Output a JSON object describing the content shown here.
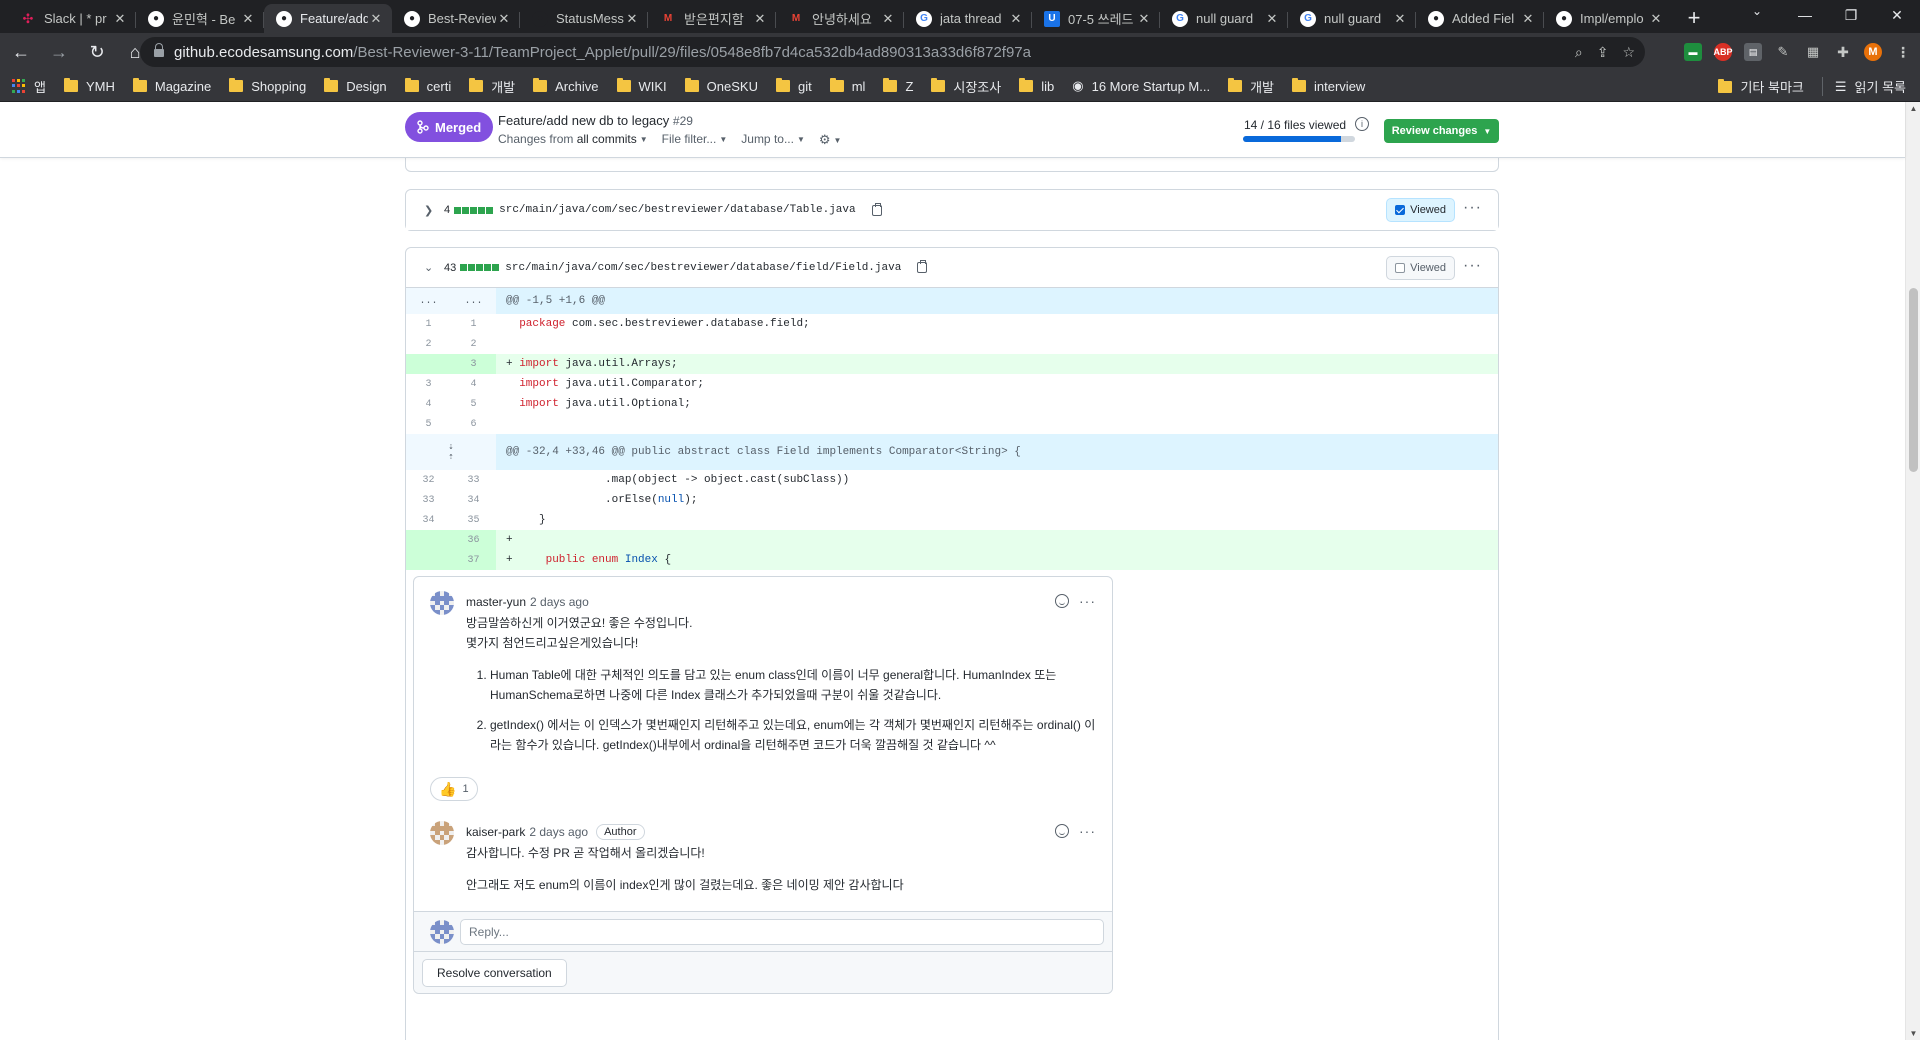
{
  "browser": {
    "tabs": [
      {
        "title": "Slack | * pr",
        "icon": "slack-icon",
        "color": "#e01e5a",
        "active": false
      },
      {
        "title": "윤민혁 - Be",
        "icon": "github-icon",
        "color": "#ffffff",
        "active": false
      },
      {
        "title": "Feature/add",
        "icon": "github-icon",
        "color": "#ffffff",
        "active": true
      },
      {
        "title": "Best-Review",
        "icon": "github-icon",
        "color": "#ffffff",
        "active": false
      },
      {
        "title": "StatusMess",
        "icon": "github-icon",
        "color": "#202124",
        "active": false
      },
      {
        "title": "받은편지함",
        "icon": "gmail-icon",
        "color": "#ea4335",
        "active": false
      },
      {
        "title": "안녕하세요",
        "icon": "gmail-icon",
        "color": "#ea4335",
        "active": false
      },
      {
        "title": "jata thread",
        "icon": "google-icon",
        "color": "#4285f4",
        "active": false
      },
      {
        "title": "07-5 쓰레드",
        "icon": "bookmark-u-icon",
        "color": "#1a73e8",
        "active": false
      },
      {
        "title": "null guard",
        "icon": "google-icon",
        "color": "#4285f4",
        "active": false
      },
      {
        "title": "null guard",
        "icon": "google-icon",
        "color": "#4285f4",
        "active": false
      },
      {
        "title": "Added Fiel",
        "icon": "github-icon",
        "color": "#ffffff",
        "active": false
      },
      {
        "title": "Impl/emplo",
        "icon": "github-icon",
        "color": "#ffffff",
        "active": false
      }
    ],
    "url_host": "github.ecodesamsung.com",
    "url_path": "/Best-Reviewer-3-11/TeamProject_Applet/pull/29/files/0548e8fb7d4ca532db4ad890313a33d6f872f97a",
    "profile_initial": "M",
    "bookmarks": [
      "앱",
      "YMH",
      "Magazine",
      "Shopping",
      "Design",
      "certi",
      "개발",
      "Archive",
      "WIKI",
      "OneSKU",
      "git",
      "ml",
      "Z",
      "시장조사",
      "lib",
      "16 More Startup M...",
      "개발",
      "interview"
    ],
    "bookmarks_right": [
      "기타 북마크",
      "읽기 목록"
    ]
  },
  "pr": {
    "state": "Merged",
    "title": "Feature/add new db to legacy",
    "number": "#29",
    "changes_from_label": "Changes from",
    "changes_from_value": "all commits",
    "file_filter": "File filter...",
    "jump_to": "Jump to...",
    "files_viewed": "14 / 16 files viewed",
    "files_viewed_fraction": 0.875,
    "review_button": "Review changes"
  },
  "files": [
    {
      "count": "4",
      "path": "src/main/java/com/sec/bestreviewer/database/Table.java",
      "viewed": true,
      "viewed_label": "Viewed",
      "expanded": false
    },
    {
      "count": "43",
      "path": "src/main/java/com/sec/bestreviewer/database/field/Field.java",
      "viewed": false,
      "viewed_label": "Viewed",
      "expanded": true
    }
  ],
  "diff": {
    "hunk1": {
      "old": "...",
      "new": "...",
      "text": "@@ -1,5 +1,6 @@"
    },
    "hunk2": "@@ -32,4 +33,46 @@ public abstract class Field implements Comparator<String> {"
  },
  "thread": {
    "comments": [
      {
        "author": "master-yun",
        "time": "2 days ago",
        "line1": "방금말씀하신게 이거였군요! 좋은 수정입니다.",
        "line2": "몇가지 첨언드리고싶은게있습니다!",
        "items": [
          "Human Table에 대한 구체적인 의도를 담고 있는 enum class인데 이름이 너무 general합니다. HumanIndex 또는 HumanSchema로하면 나중에 다른 Index 클래스가 추가되었을때 구분이 쉬울 것같습니다.",
          "getIndex() 에서는 이 인덱스가 몇번째인지 리턴해주고 있는데요, enum에는 각 객체가 몇번째인지 리턴해주는 ordinal() 이라는 함수가 있습니다. getIndex()내부에서 ordinal을 리턴해주면 코드가 더욱 깔끔해질 것 같습니다 ^^"
        ],
        "reaction_count": "1"
      },
      {
        "author": "kaiser-park",
        "time": "2 days ago",
        "badge": "Author",
        "line1": "감사합니다. 수정 PR 곧 작업해서 올리겠습니다!",
        "line2": "안그래도 저도 enum의 이름이 index인게 많이 걸렸는데요. 좋은 네이밍 제안 감사합니다"
      }
    ],
    "reply_placeholder": "Reply...",
    "resolve_label": "Resolve conversation"
  }
}
